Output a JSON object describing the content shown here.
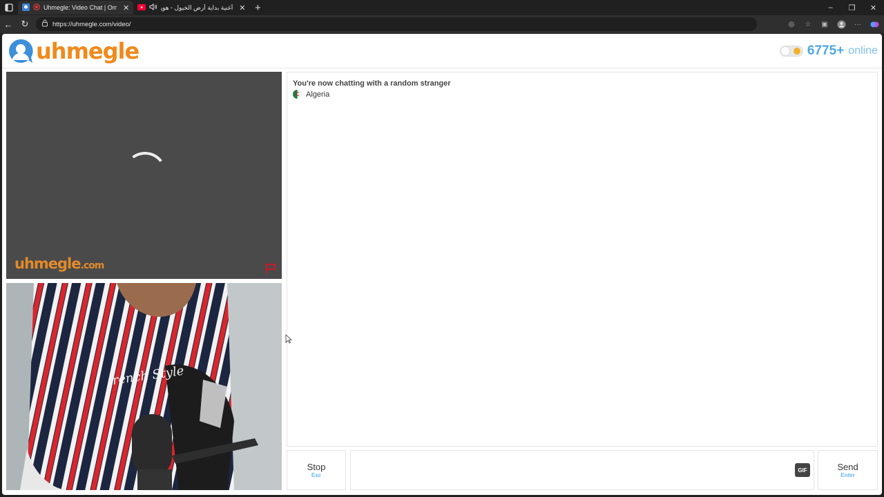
{
  "browser": {
    "tabs": [
      {
        "title": "Uhmegle: Video Chat | Ome",
        "active": true
      },
      {
        "title": "أغنية بداية أرض الخيول - هوري",
        "active": false
      }
    ],
    "url": "https://uhmegle.com/video/"
  },
  "header": {
    "logo_text": "uhmegle",
    "online_count": "6775+",
    "online_label": "online"
  },
  "stranger_video": {
    "watermark": "uhmegle",
    "watermark_suffix": ".com"
  },
  "chat": {
    "status": "You're now chatting with a random stranger",
    "country": "Algeria"
  },
  "controls": {
    "stop_label": "Stop",
    "stop_shortcut": "Esc",
    "gif_label": "GIF",
    "send_label": "Send",
    "send_shortcut": "Enter",
    "message_placeholder": ""
  },
  "colors": {
    "brand_orange": "#f08a1c",
    "brand_blue": "#4fa7e6",
    "report_red": "#c21d2a"
  }
}
